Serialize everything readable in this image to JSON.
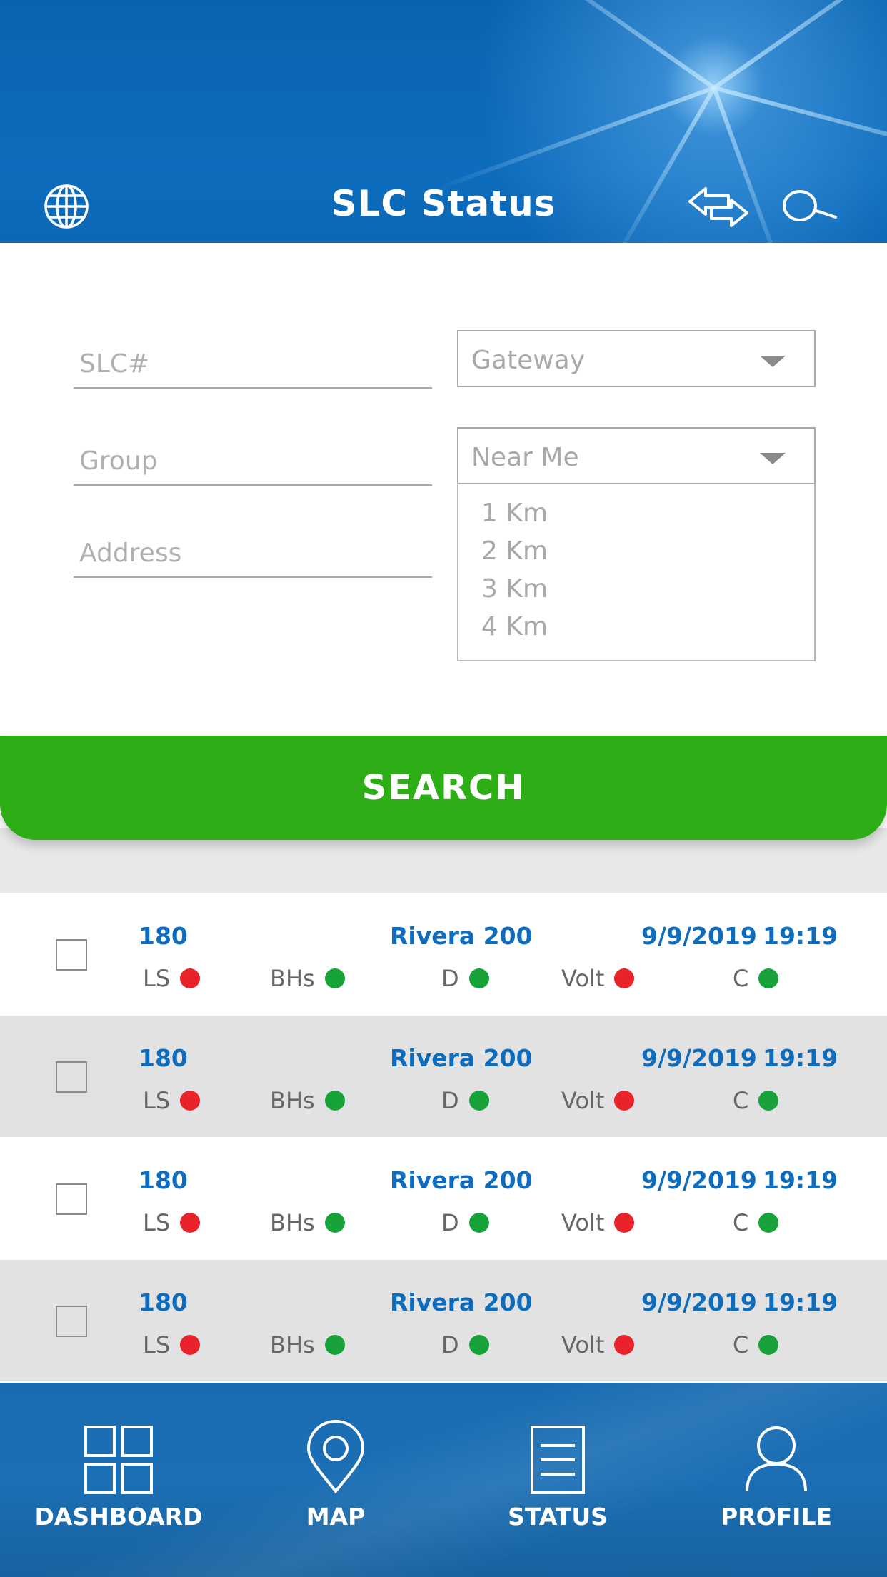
{
  "header": {
    "title": "SLC Status",
    "icons": {
      "left": "globe-icon",
      "right1": "swap-arrows-icon",
      "right2": "search-icon"
    }
  },
  "form": {
    "slc_placeholder": "SLC#",
    "group_placeholder": "Group",
    "address_placeholder": "Address",
    "gateway_select": "Gateway",
    "distance_select": "Near Me",
    "distance_options": [
      "1 Km",
      "2 Km",
      "3 Km",
      "4 Km"
    ]
  },
  "search_button": {
    "label": "SEARCH",
    "color": "#2eae16"
  },
  "status_labels": {
    "ls": "LS",
    "bhs": "BHs",
    "d": "D",
    "volt": "Volt",
    "c": "C"
  },
  "colors": {
    "red": "#e8232b",
    "green": "#17a33a",
    "blue": "#0d6cbd"
  },
  "rows": [
    {
      "id": "180",
      "location": "Rivera 200",
      "date": "9/9/2019",
      "time": "19:19",
      "ls": "red",
      "bhs": "green",
      "d": "green",
      "volt": "red",
      "c": "green"
    },
    {
      "id": "180",
      "location": "Rivera 200",
      "date": "9/9/2019",
      "time": "19:19",
      "ls": "red",
      "bhs": "green",
      "d": "green",
      "volt": "red",
      "c": "green"
    },
    {
      "id": "180",
      "location": "Rivera 200",
      "date": "9/9/2019",
      "time": "19:19",
      "ls": "red",
      "bhs": "green",
      "d": "green",
      "volt": "red",
      "c": "green"
    },
    {
      "id": "180",
      "location": "Rivera 200",
      "date": "9/9/2019",
      "time": "19:19",
      "ls": "red",
      "bhs": "green",
      "d": "green",
      "volt": "red",
      "c": "green"
    }
  ],
  "bottom_nav": [
    {
      "label": "DASHBOARD",
      "icon": "dashboard-grid-icon"
    },
    {
      "label": "MAP",
      "icon": "map-pin-icon"
    },
    {
      "label": "STATUS",
      "icon": "status-document-icon"
    },
    {
      "label": "PROFILE",
      "icon": "profile-person-icon"
    }
  ]
}
